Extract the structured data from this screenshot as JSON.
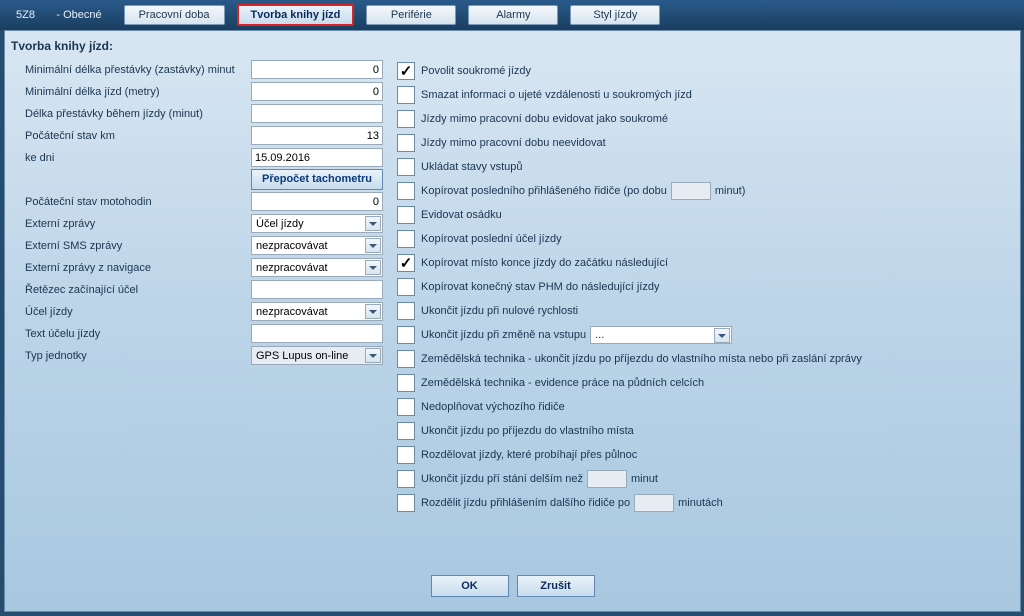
{
  "tabs": {
    "vehicle_code": "5Z8       - Obecné",
    "pracovni_doba": "Pracovní doba",
    "tvorba_knihy": "Tvorba knihy jízd",
    "periferie": "Periférie",
    "alarmy": "Alarmy",
    "styl_jizdy": "Styl jízdy"
  },
  "panel_title": "Tvorba knihy jízd:",
  "left": {
    "min_break_label": "Minimální délka přestávky (zastávky) minut",
    "min_break_value": "0",
    "min_trip_label": "Minimální délka jízd (metry)",
    "min_trip_value": "0",
    "break_during_label": "Délka přestávky během jízdy (minut)",
    "break_during_value": "",
    "start_km_label": "Počáteční stav km",
    "start_km_value": "13",
    "ke_dni_label": "ke dni",
    "ke_dni_value": "15.09.2016",
    "recalc_btn": "Přepočet tachometru",
    "start_moto_label": "Počáteční stav motohodin",
    "start_moto_value": "0",
    "ext_zpravy_label": "Externí zprávy",
    "ext_zpravy_value": "Účel jízdy",
    "ext_sms_label": "Externí SMS zprávy",
    "ext_sms_value": "nezpracovávat",
    "ext_nav_label": "Externí zprávy z navigace",
    "ext_nav_value": "nezpracovávat",
    "retezec_label": "Řetězec začínající účel",
    "retezec_value": "",
    "ucel_jizdy_label": "Účel jízdy",
    "ucel_jizdy_value": "nezpracovávat",
    "text_ucelu_label": "Text účelu jízdy",
    "text_ucelu_value": "",
    "typ_jednotky_label": "Typ jednotky",
    "typ_jednotky_value": "GPS Lupus on-line"
  },
  "right": {
    "r1": "Povolit soukromé jízdy",
    "r2": "Smazat informaci o ujeté vzdálenosti u soukromých jízd",
    "r3": "Jízdy mimo pracovní dobu evidovat jako soukromé",
    "r4": "Jízdy mimo pracovní dobu neevidovat",
    "r5": "Ukládat stavy vstupů",
    "r6_pre": "Kopírovat posledního přihlášeného řidiče (po dobu",
    "r6_post": "minut)",
    "r7": "Evidovat osádku",
    "r8": "Kopírovat poslední účel jízdy",
    "r9": "Kopírovat místo konce jízdy do začátku následující",
    "r10": "Kopírovat konečný stav PHM do následující jízdy",
    "r11": "Ukončit jízdu při nulové rychlosti",
    "r12": "Ukončit jízdu při změně na vstupu",
    "r12_sel": "...",
    "r13": "Zemědělská technika - ukončit jízdu po příjezdu do vlastního místa nebo při zaslání zprávy",
    "r14": "Zemědělská technika - evidence práce na půdních celcích",
    "r15": "Nedoplňovat výchozího řidiče",
    "r16": "Ukončit jízdu po příjezdu do vlastního místa",
    "r17": "Rozdělovat jízdy, které probíhají přes půlnoc",
    "r18_pre": "Ukončit jízdu pří stání delším než",
    "r18_post": "minut",
    "r19_pre": "Rozdělit jízdu přihlášením dalšího řidiče po",
    "r19_post": "minutách"
  },
  "footer": {
    "ok": "OK",
    "cancel": "Zrušit"
  }
}
